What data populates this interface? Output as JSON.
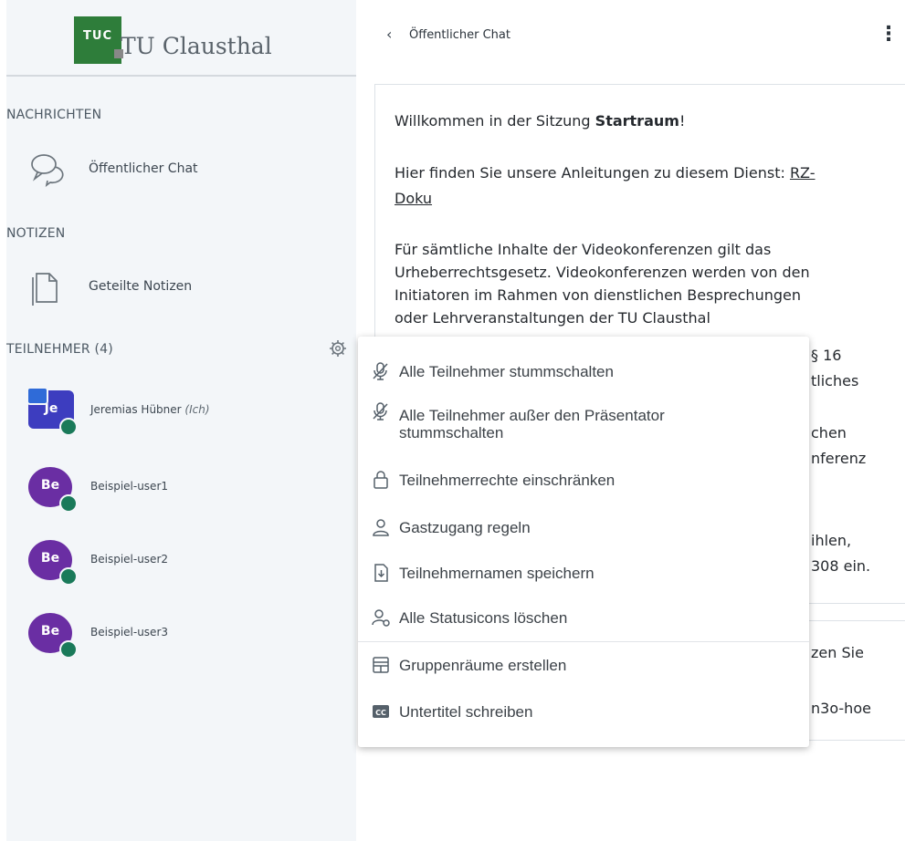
{
  "logo": {
    "mark_text": "TUC",
    "name": "TU Clausthal"
  },
  "sidebar": {
    "messages_title": "NACHRICHTEN",
    "public_chat": "Öffentlicher Chat",
    "notes_title": "NOTIZEN",
    "shared_notes": "Geteilte Notizen",
    "participants_title": "TEILNEHMER (4)"
  },
  "participants": [
    {
      "initials": "Je",
      "name": "Jeremias Hübner",
      "suffix": "(Ich)"
    },
    {
      "initials": "Be",
      "name": "Beispiel-user1"
    },
    {
      "initials": "Be",
      "name": "Beispiel-user2"
    },
    {
      "initials": "Be",
      "name": "Beispiel-user3"
    }
  ],
  "chat": {
    "header_title": "Öffentlicher Chat",
    "welcome_prefix": "Willkommen in der Sitzung ",
    "welcome_room": "Startraum",
    "welcome_suffix": "!",
    "guide_line1": "Hier finden Sie unsere Anleitungen zu diesem Dienst: ",
    "guide_link1": "RZ-",
    "guide_link2": "Doku",
    "law_line1": "Für sämtliche Inhalte der Videokonferenzen gilt das",
    "law_line2": "Urheberrechtsgesetz. Videokonferenzen werden von den",
    "law_line3": "Initiatoren im Rahmen von dienstlichen Besprechungen",
    "law_line4": "oder Lehrveranstaltungen der TU Clausthal",
    "trunc": [
      "§ 16",
      "tliches",
      "chen",
      "nferenz",
      "ihlen,",
      "308 ein.",
      "zen Sie",
      "n3o-hoe"
    ]
  },
  "menu": {
    "items": [
      "Alle Teilnehmer stummschalten",
      "Alle Teilnehmer außer den Präsentator",
      "stummschalten",
      "Teilnehmerrechte einschränken",
      "Gastzugang regeln",
      "Teilnehmernamen speichern",
      "Alle Statusicons löschen",
      "Gruppenräume erstellen",
      "Untertitel schreiben"
    ]
  },
  "colors": {
    "accent": "#2e7d3a",
    "avatar_self": "#3d3dbf",
    "avatar_other": "#6a2ea3",
    "status": "#1a7a5a"
  }
}
